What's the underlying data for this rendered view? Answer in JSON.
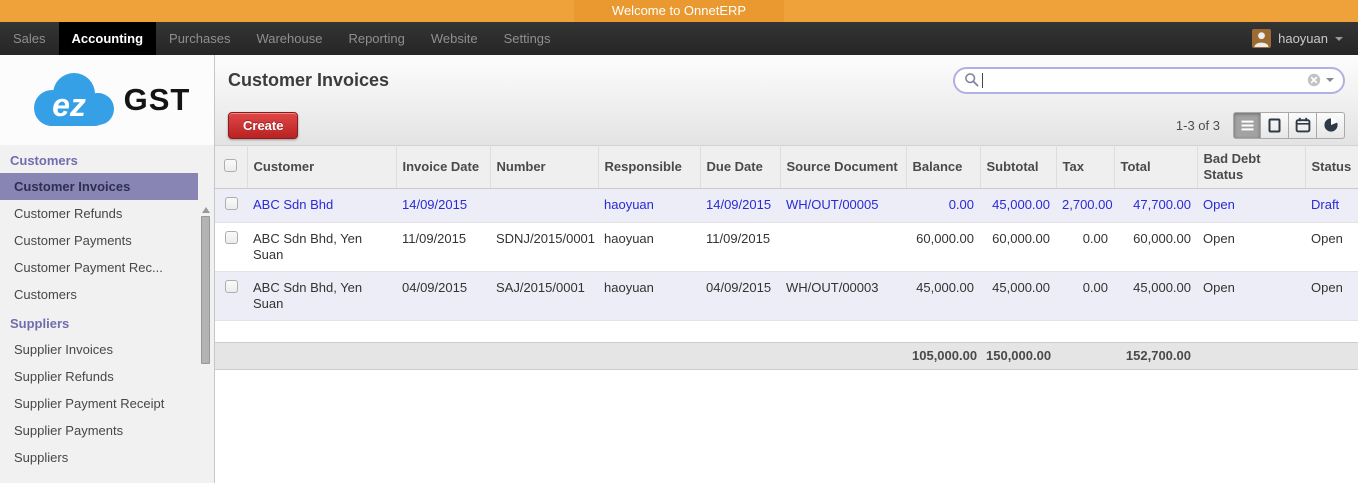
{
  "topbar": {
    "welcome_text": "Welcome to OnnetERP"
  },
  "navbar": {
    "items": [
      {
        "label": "Sales"
      },
      {
        "label": "Accounting",
        "active": true
      },
      {
        "label": "Purchases"
      },
      {
        "label": "Warehouse"
      },
      {
        "label": "Reporting"
      },
      {
        "label": "Website"
      },
      {
        "label": "Settings"
      }
    ],
    "user": {
      "name": "haoyuan"
    }
  },
  "sidebar": {
    "logo": {
      "cloud_text": "ez",
      "brand_text": "GST"
    },
    "sections": [
      {
        "title": "Customers",
        "items": [
          {
            "label": "Customer Invoices",
            "selected": true
          },
          {
            "label": "Customer Refunds"
          },
          {
            "label": "Customer Payments"
          },
          {
            "label": "Customer Payment Rec..."
          },
          {
            "label": "Customers"
          }
        ]
      },
      {
        "title": "Suppliers",
        "items": [
          {
            "label": "Supplier Invoices"
          },
          {
            "label": "Supplier Refunds"
          },
          {
            "label": "Supplier Payment Receipt"
          },
          {
            "label": "Supplier Payments"
          },
          {
            "label": "Suppliers"
          }
        ]
      }
    ]
  },
  "main": {
    "title": "Customer Invoices",
    "search": {
      "value": ""
    },
    "toolbar": {
      "create_label": "Create",
      "pager": "1-3 of 3",
      "view_switcher": [
        "list",
        "form",
        "calendar",
        "graph"
      ],
      "active_view": "list"
    },
    "table": {
      "columns": [
        "Customer",
        "Invoice Date",
        "Number",
        "Responsible",
        "Due Date",
        "Source Document",
        "Balance",
        "Subtotal",
        "Tax",
        "Total",
        "Bad Debt Status",
        "Status"
      ],
      "rows": [
        {
          "customer": "ABC Sdn Bhd",
          "invoice_date": "14/09/2015",
          "number": "",
          "responsible": "haoyuan",
          "due_date": "14/09/2015",
          "source_document": "WH/OUT/00005",
          "balance": "0.00",
          "subtotal": "45,000.00",
          "tax": "2,700.00",
          "total": "47,700.00",
          "bad_debt_status": "Open",
          "status": "Draft",
          "state": "draft"
        },
        {
          "customer": "ABC Sdn Bhd, Yen Suan",
          "invoice_date": "11/09/2015",
          "number": "SDNJ/2015/0001",
          "responsible": "haoyuan",
          "due_date": "11/09/2015",
          "source_document": "",
          "balance": "60,000.00",
          "subtotal": "60,000.00",
          "tax": "0.00",
          "total": "60,000.00",
          "bad_debt_status": "Open",
          "status": "Open",
          "state": "open"
        },
        {
          "customer": "ABC Sdn Bhd, Yen Suan",
          "invoice_date": "04/09/2015",
          "number": "SAJ/2015/0001",
          "responsible": "haoyuan",
          "due_date": "04/09/2015",
          "source_document": "WH/OUT/00003",
          "balance": "45,000.00",
          "subtotal": "45,000.00",
          "tax": "0.00",
          "total": "45,000.00",
          "bad_debt_status": "Open",
          "status": "Open",
          "state": "open"
        }
      ],
      "totals": {
        "balance": "105,000.00",
        "subtotal": "150,000.00",
        "tax": "",
        "total": "152,700.00"
      }
    }
  },
  "colors": {
    "topbar_orange": "#efa23a",
    "nav_bg": "#2a2a2a",
    "draft_blue": "#2a2ad6",
    "create_red": "#c12c2c",
    "selected_item_bg": "#8885b5",
    "section_title_purple": "#6e6eae",
    "logo_blue": "#36a0e6",
    "row_stripe": "#ecedf7"
  }
}
